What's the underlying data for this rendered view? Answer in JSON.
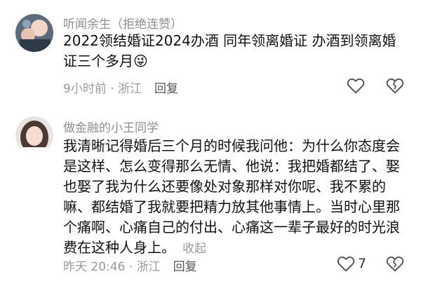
{
  "comments": [
    {
      "username": "听闻余生（拒绝连赞）",
      "text": "2022领结婚证2024办酒 同年领离婚证 办酒到领离婚证三个多月",
      "emoji": "😜",
      "time": "9小时前",
      "location": "浙江",
      "reply_label": "回复",
      "like_count": ""
    },
    {
      "username": "做金融的小王同学",
      "text": "我清晰记得婚后三个月的时候我问他：为什么你态度会是这样、怎么变得那么无情、他说：我把婚都结了、娶也娶了我为什么还要像处对象那样对你呢、我不累的嘛、都结婚了我就要把精力放其他事情上。当时心里那个痛啊、心痛自己的付出、心痛这一辈子最好的时光浪费在这种人身上。",
      "collapse_label": "收起",
      "time": "昨天 20:46",
      "location": "浙江",
      "reply_label": "回复",
      "like_count": "7"
    }
  ],
  "meta_separator": " · "
}
